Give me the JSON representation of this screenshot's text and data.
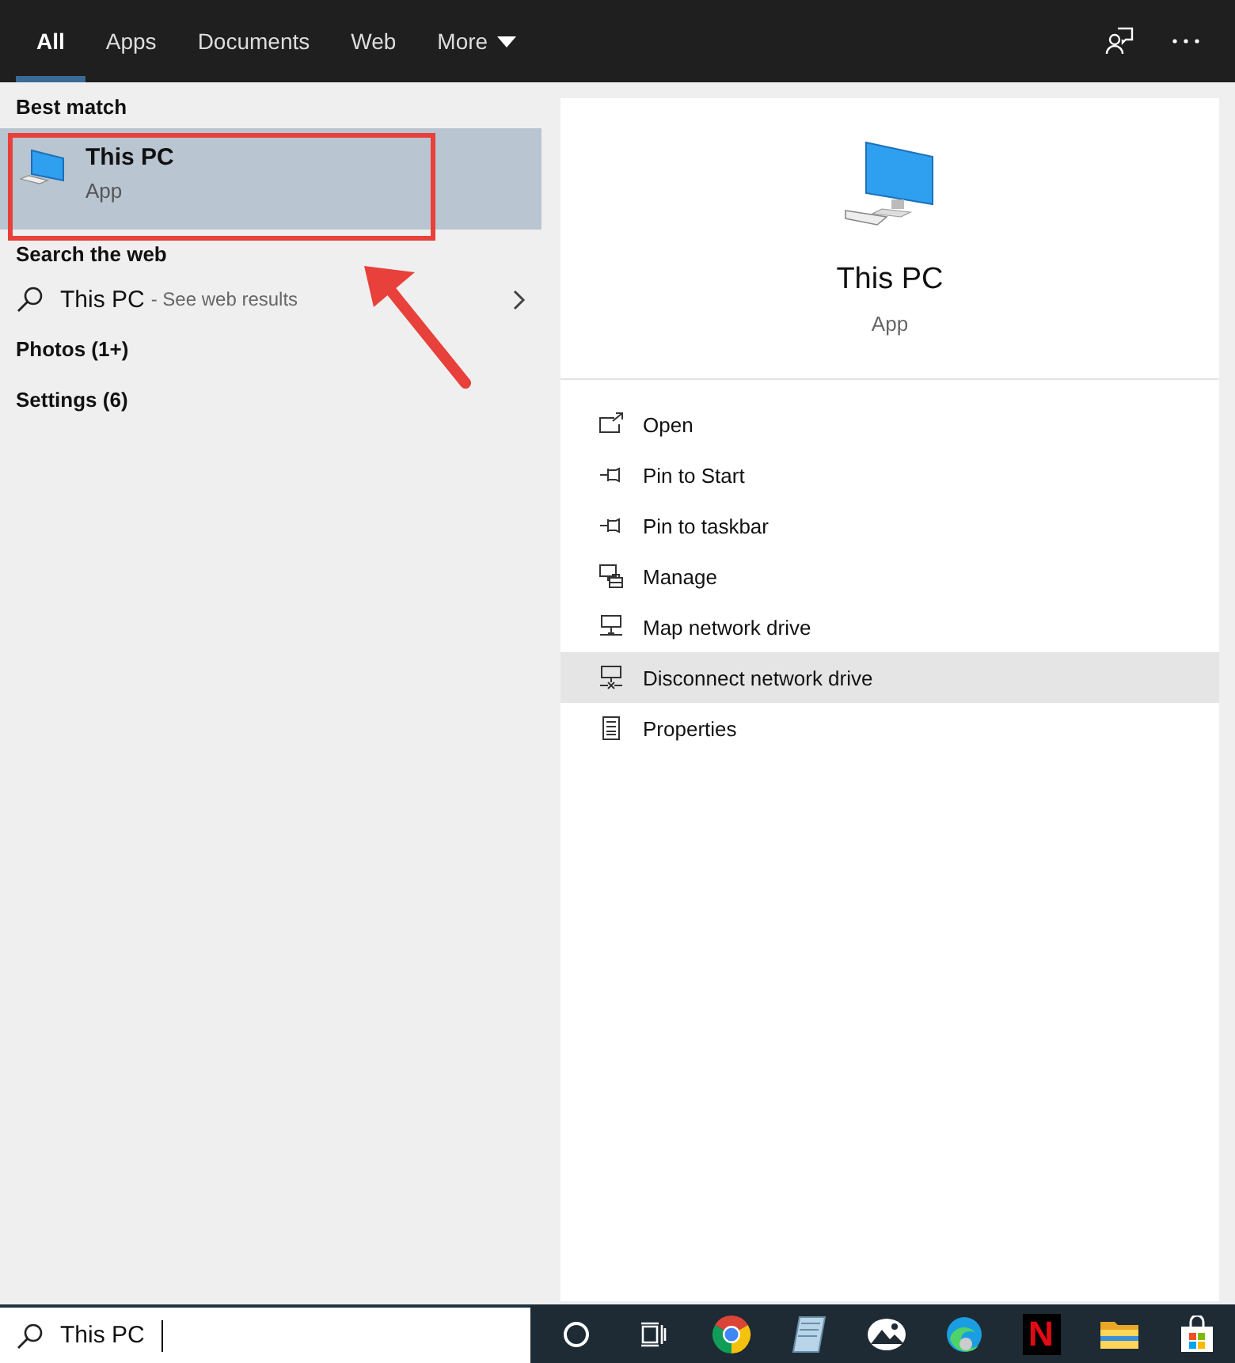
{
  "tabs": [
    {
      "label": "All",
      "selected": true,
      "dropdown": false
    },
    {
      "label": "Apps",
      "selected": false,
      "dropdown": false
    },
    {
      "label": "Documents",
      "selected": false,
      "dropdown": false
    },
    {
      "label": "Web",
      "selected": false,
      "dropdown": false
    },
    {
      "label": "More",
      "selected": false,
      "dropdown": true
    }
  ],
  "best_match": {
    "heading": "Best match",
    "title": "This PC",
    "subtitle": "App",
    "selected": true
  },
  "web": {
    "heading": "Search the web",
    "query": "This PC",
    "suffix": "- See web results"
  },
  "categories": [
    "Photos (1+)",
    "Settings (6)"
  ],
  "preview": {
    "title": "This PC",
    "subtitle": "App",
    "actions": [
      {
        "label": "Open",
        "kind": "open",
        "selected": false
      },
      {
        "label": "Pin to Start",
        "kind": "pin",
        "selected": false
      },
      {
        "label": "Pin to taskbar",
        "kind": "pin",
        "selected": false
      },
      {
        "label": "Manage",
        "kind": "manage",
        "selected": false
      },
      {
        "label": "Map network drive",
        "kind": "network",
        "selected": false
      },
      {
        "label": "Disconnect network drive",
        "kind": "disconnect",
        "selected": true
      },
      {
        "label": "Properties",
        "kind": "properties",
        "selected": false
      }
    ]
  },
  "search": {
    "value": "This PC"
  },
  "taskbar": [
    {
      "kind": "cortana"
    },
    {
      "kind": "taskview"
    },
    {
      "kind": "chrome"
    },
    {
      "kind": "notes"
    },
    {
      "kind": "photos"
    },
    {
      "kind": "edge"
    },
    {
      "kind": "netflix",
      "glyph": "N"
    },
    {
      "kind": "explorer"
    },
    {
      "kind": "store"
    }
  ]
}
